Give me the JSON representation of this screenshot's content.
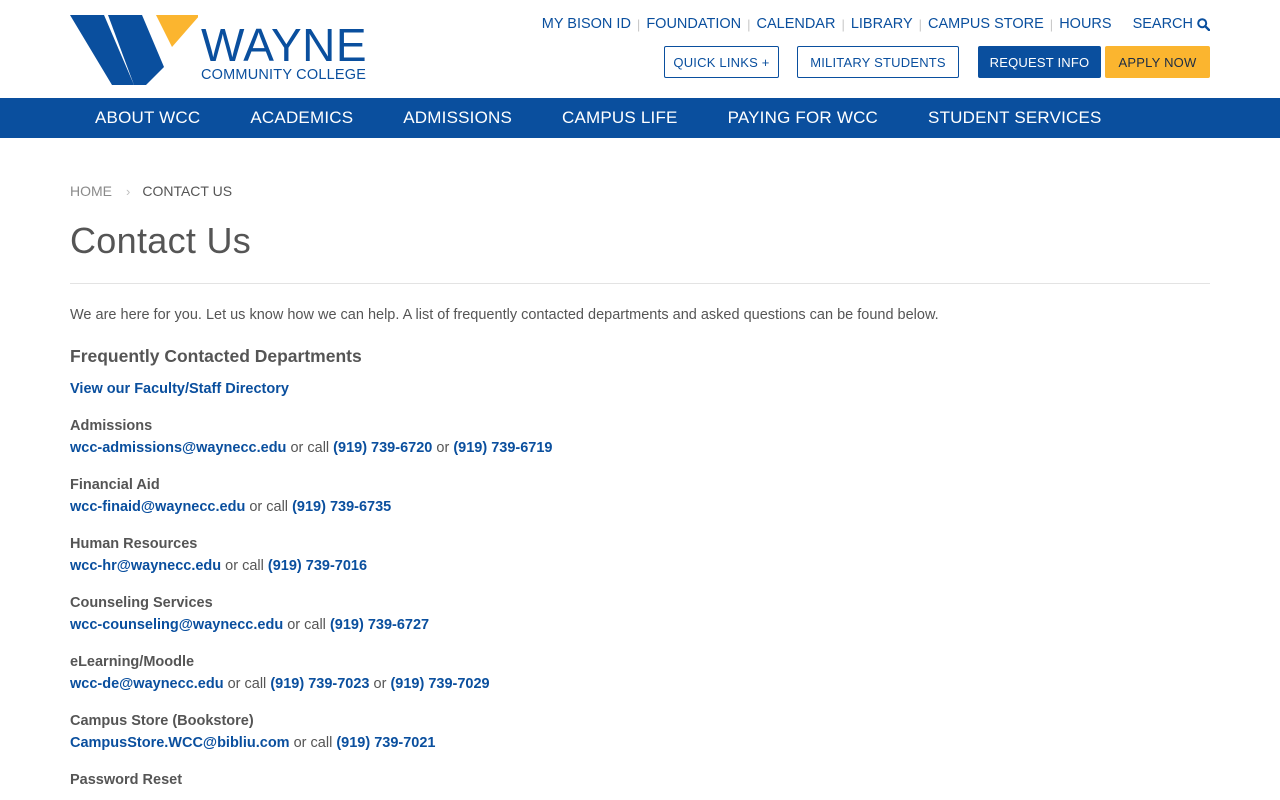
{
  "logo": {
    "name": "WAYNE",
    "subtitle": "COMMUNITY COLLEGE",
    "colors": {
      "blue": "#0a4f9e",
      "gold": "#fbb52f"
    }
  },
  "util_nav": {
    "links": [
      "MY BISON ID",
      "FOUNDATION",
      "CALENDAR",
      "LIBRARY",
      "CAMPUS STORE",
      "HOURS"
    ],
    "search_label": "SEARCH",
    "search_icon": "magnifier-icon"
  },
  "buttons": {
    "quick_links": "QUICK LINKS +",
    "military": "MILITARY STUDENTS",
    "request_info": "REQUEST INFO",
    "apply_now": "APPLY NOW"
  },
  "main_nav": [
    "ABOUT WCC",
    "ACADEMICS",
    "ADMISSIONS",
    "CAMPUS LIFE",
    "PAYING FOR WCC",
    "STUDENT SERVICES"
  ],
  "breadcrumb": {
    "home": "HOME",
    "separator": "›",
    "current": "CONTACT US"
  },
  "page": {
    "title": "Contact Us",
    "intro": "We are here for you. Let us know how we can help. A list of frequently contacted departments and asked questions can be found below.",
    "section_title": "Frequently Contacted Departments",
    "directory_link": "View our Faculty/Staff Directory"
  },
  "departments": [
    {
      "name": "Admissions",
      "email": "wcc-admissions@waynecc.edu",
      "connector": "or call",
      "phone1": "(919) 739-6720",
      "or": "or",
      "phone2": "(919) 739-6719"
    },
    {
      "name": "Financial Aid",
      "email": "wcc-finaid@waynecc.edu",
      "connector": "or call",
      "phone1": "(919) 739-6735"
    },
    {
      "name": "Human Resources",
      "email": "wcc-hr@waynecc.edu",
      "connector": "or call",
      "phone1": "(919) 739-7016"
    },
    {
      "name": "Counseling Services",
      "email": "wcc-counseling@waynecc.edu",
      "connector": "or call",
      "phone1": "(919) 739-6727"
    },
    {
      "name": "eLearning/Moodle",
      "email": "wcc-de@waynecc.edu",
      "connector": "or call",
      "phone1": "(919) 739-7023",
      "or": "or",
      "phone2": "(919) 739-7029"
    },
    {
      "name": "Campus Store (Bookstore)",
      "email": "CampusStore.WCC@bibliu.com",
      "connector": "or call",
      "phone1": "(919) 739-7021"
    },
    {
      "name": "Password Reset"
    }
  ]
}
